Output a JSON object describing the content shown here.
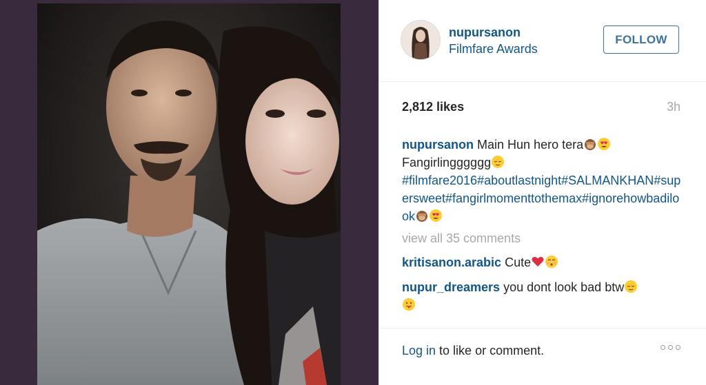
{
  "post": {
    "username": "nupursanon",
    "location": "Filmfare Awards",
    "follow_label": "FOLLOW",
    "likes": "2,812 likes",
    "time": "3h"
  },
  "caption": {
    "username": "nupursanon",
    "text1": "Main Hun hero tera",
    "text2": "Fangirlingggggg",
    "hashtags": "#filmfare2016#aboutlastnight#SALMANKHAN#supersweet#fangirlmomenttothemax#ignorehowbadilook"
  },
  "comments": {
    "view_all": "view all 35 comments",
    "items": [
      {
        "username": "kritisanon.arabic",
        "text": "Cute"
      },
      {
        "username": "nupur_dreamers",
        "text": "you dont look bad btw"
      }
    ]
  },
  "footer": {
    "login_link": "Log in",
    "login_text": " to like or comment."
  },
  "colors": {
    "link": "#125688",
    "follow": "#3f729b",
    "muted": "#a5a7aa",
    "photo_panel": "#3a2a3d"
  },
  "icons": [
    "see-no-evil-monkey-icon",
    "heart-eyes-icon",
    "relieved-face-icon",
    "red-heart-icon",
    "kissing-face-icon",
    "tongue-face-icon",
    "more-options-icon"
  ]
}
